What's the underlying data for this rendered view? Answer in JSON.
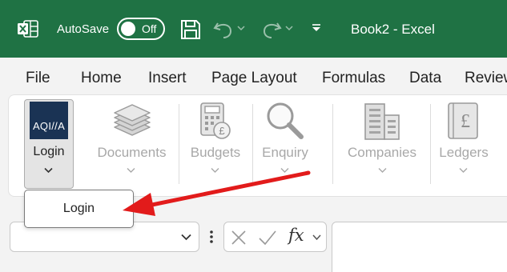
{
  "titlebar": {
    "autosave_label": "AutoSave",
    "autosave_state": "Off",
    "document_title": "Book2  -  Excel"
  },
  "menu": {
    "items": [
      "File",
      "Home",
      "Insert",
      "Page Layout",
      "Formulas",
      "Data",
      "Review"
    ]
  },
  "ribbon": {
    "logo_text": "AQI//A",
    "login_label": "Login",
    "buttons": [
      {
        "label": "Documents",
        "icon": "documents-stack-icon"
      },
      {
        "label": "Budgets",
        "icon": "calculator-pound-icon"
      },
      {
        "label": "Enquiry",
        "icon": "magnifier-icon"
      },
      {
        "label": "Companies",
        "icon": "buildings-icon"
      },
      {
        "label": "Ledgers",
        "icon": "ledger-pound-icon"
      }
    ]
  },
  "login_dropdown": {
    "items": [
      "Login"
    ]
  },
  "formula_bar": {
    "fx_label": "fx",
    "name_box_value": "",
    "formula_value": ""
  },
  "colors": {
    "titlebar_bg": "#1f7244",
    "aqilla_bg": "#1a3354",
    "annotation_arrow": "#e21b1b",
    "disabled_text": "#a8a8a8"
  }
}
